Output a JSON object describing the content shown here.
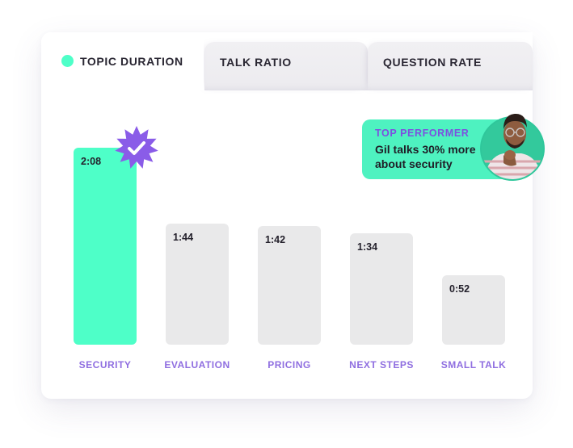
{
  "tabs": [
    {
      "label": "TOPIC DURATION",
      "active": true,
      "indicator_color": "#4effc8"
    },
    {
      "label": "TALK RATIO",
      "active": false
    },
    {
      "label": "QUESTION RATE",
      "active": false
    }
  ],
  "callout": {
    "kicker": "TOP PERFORMER",
    "message": "Gil talks 30% more about security",
    "avatar": "person-photo"
  },
  "badge": {
    "icon": "verified-check-badge-icon",
    "color": "#8a5ce8"
  },
  "colors": {
    "accent": "#4effc8",
    "bar_default": "#e9e9ea",
    "category_label": "#8f6ee0",
    "kicker": "#7d4fe0"
  },
  "chart_data": {
    "type": "bar",
    "title": "Topic Duration",
    "xlabel": "",
    "ylabel": "",
    "categories": [
      "SECURITY",
      "EVALUATION",
      "PRICING",
      "NEXT STEPS",
      "SMALL TALK"
    ],
    "values": [
      128,
      104,
      102,
      94,
      52
    ],
    "value_units": "seconds",
    "value_labels": [
      "2:08",
      "1:44",
      "1:42",
      "1:34",
      "0:52"
    ],
    "highlighted": "SECURITY",
    "grid": false,
    "axes_visible": false
  }
}
